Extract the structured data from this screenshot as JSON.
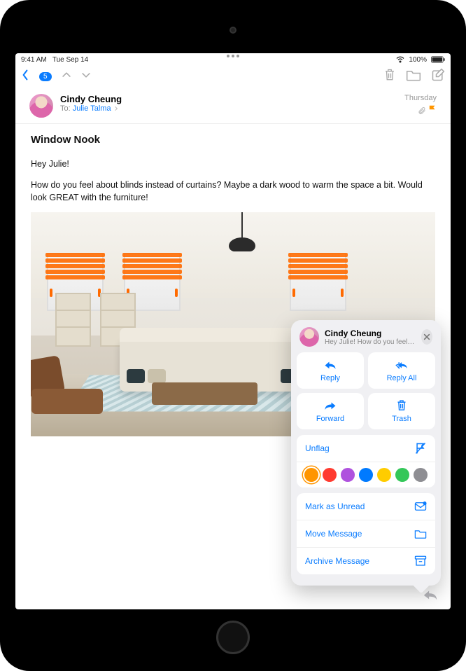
{
  "status": {
    "time": "9:41 AM",
    "date": "Tue Sep 14",
    "network": "",
    "battery": "100%"
  },
  "toolbar": {
    "badge": "5"
  },
  "message": {
    "from": "Cindy Cheung",
    "to_label": "To:",
    "to_name": "Julie Talma",
    "date": "Thursday",
    "subject": "Window Nook",
    "greeting": "Hey Julie!",
    "body": "How do you feel about blinds instead of curtains? Maybe a dark wood to warm the space a bit. Would look GREAT with the furniture!"
  },
  "sheet": {
    "title": "Cindy Cheung",
    "subtitle": "Hey Julie! How do you feel ab…",
    "reply": "Reply",
    "reply_all": "Reply All",
    "forward": "Forward",
    "trash": "Trash",
    "unflag": "Unflag",
    "mark_unread": "Mark as Unread",
    "move": "Move Message",
    "archive": "Archive Message",
    "colors": [
      "#ff9500",
      "#ff3b30",
      "#af52de",
      "#007aff",
      "#ffcc00",
      "#34c759",
      "#8e8e93"
    ],
    "selected_color_index": 0
  }
}
